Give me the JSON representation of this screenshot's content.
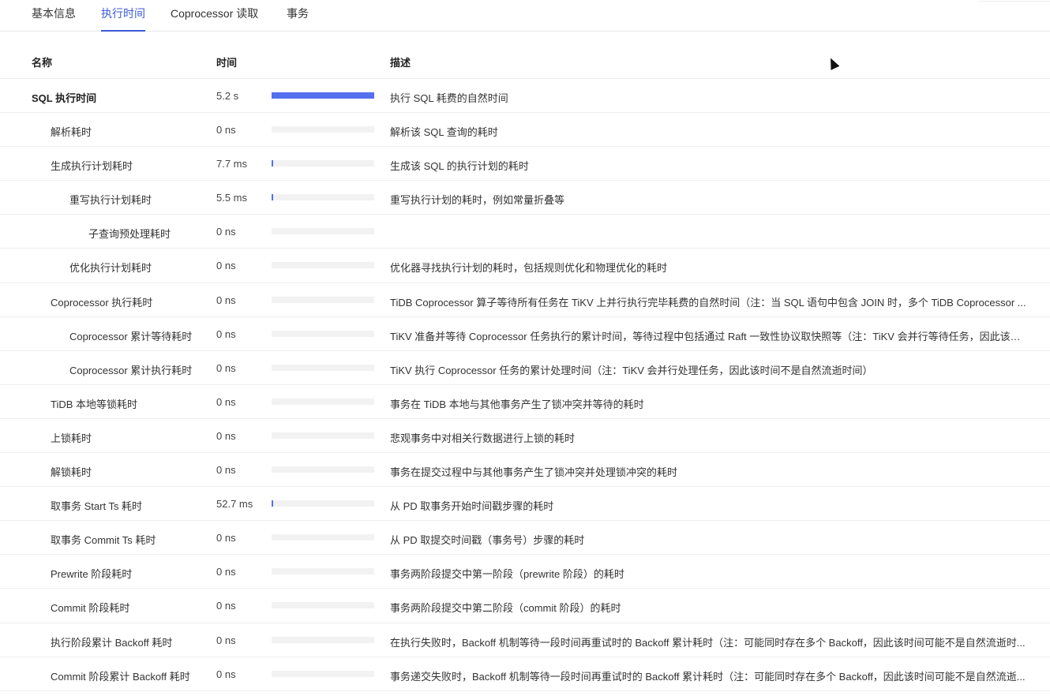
{
  "tabs": [
    {
      "label": "基本信息",
      "active": false
    },
    {
      "label": "执行时间",
      "active": true
    },
    {
      "label": "Coprocessor 读取",
      "active": false
    },
    {
      "label": "事务",
      "active": false
    }
  ],
  "header": {
    "name": "名称",
    "time": "时间",
    "desc": "描述"
  },
  "accent": "#5470ef",
  "rows": [
    {
      "name": "SQL 执行时间",
      "level": 0,
      "bold": true,
      "time": "5.2 s",
      "fraction": 1.0,
      "desc": "执行 SQL 耗费的自然时间"
    },
    {
      "name": "解析耗时",
      "level": 1,
      "time": "0 ns",
      "fraction": 0,
      "desc": "解析该 SQL 查询的耗时"
    },
    {
      "name": "生成执行计划耗时",
      "level": 1,
      "time": "7.7 ms",
      "fraction": 0.0015,
      "desc": "生成该 SQL 的执行计划的耗时"
    },
    {
      "name": "重写执行计划耗时",
      "level": 2,
      "time": "5.5 ms",
      "fraction": 0.001,
      "desc": "重写执行计划的耗时，例如常量折叠等"
    },
    {
      "name": "子查询预处理耗时",
      "level": 3,
      "time": "0 ns",
      "fraction": 0,
      "desc": ""
    },
    {
      "name": "优化执行计划耗时",
      "level": 2,
      "time": "0 ns",
      "fraction": 0,
      "desc": "优化器寻找执行计划的耗时，包括规则优化和物理优化的耗时"
    },
    {
      "name": "Coprocessor 执行耗时",
      "level": 1,
      "time": "0 ns",
      "fraction": 0,
      "desc": "TiDB Coprocessor 算子等待所有任务在 TiKV 上并行执行完毕耗费的自然时间（注：当 SQL 语句中包含 JOIN 时，多个 TiDB Coprocessor ..."
    },
    {
      "name": "Coprocessor 累计等待耗时",
      "level": 2,
      "time": "0 ns",
      "fraction": 0,
      "desc": "TiKV 准备并等待 Coprocessor 任务执行的累计时间，等待过程中包括通过 Raft 一致性协议取快照等（注：TiKV 会并行等待任务，因此该时..."
    },
    {
      "name": "Coprocessor 累计执行耗时",
      "level": 2,
      "time": "0 ns",
      "fraction": 0,
      "desc": "TiKV 执行 Coprocessor 任务的累计处理时间（注：TiKV 会并行处理任务，因此该时间不是自然流逝时间）"
    },
    {
      "name": "TiDB 本地等锁耗时",
      "level": 1,
      "time": "0 ns",
      "fraction": 0,
      "desc": "事务在 TiDB 本地与其他事务产生了锁冲突并等待的耗时"
    },
    {
      "name": "上锁耗时",
      "level": 1,
      "time": "0 ns",
      "fraction": 0,
      "desc": "悲观事务中对相关行数据进行上锁的耗时"
    },
    {
      "name": "解锁耗时",
      "level": 1,
      "time": "0 ns",
      "fraction": 0,
      "desc": "事务在提交过程中与其他事务产生了锁冲突并处理锁冲突的耗时"
    },
    {
      "name": "取事务 Start Ts 耗时",
      "level": 1,
      "time": "52.7 ms",
      "fraction": 0.01,
      "desc": "从 PD 取事务开始时间戳步骤的耗时"
    },
    {
      "name": "取事务 Commit Ts 耗时",
      "level": 1,
      "time": "0 ns",
      "fraction": 0,
      "desc": "从 PD 取提交时间戳（事务号）步骤的耗时"
    },
    {
      "name": "Prewrite 阶段耗时",
      "level": 1,
      "time": "0 ns",
      "fraction": 0,
      "desc": "事务两阶段提交中第一阶段（prewrite 阶段）的耗时"
    },
    {
      "name": "Commit 阶段耗时",
      "level": 1,
      "time": "0 ns",
      "fraction": 0,
      "desc": "事务两阶段提交中第二阶段（commit 阶段）的耗时"
    },
    {
      "name": "执行阶段累计 Backoff 耗时",
      "level": 1,
      "time": "0 ns",
      "fraction": 0,
      "desc": "在执行失败时，Backoff 机制等待一段时间再重试时的 Backoff 累计耗时（注：可能同时存在多个 Backoff，因此该时间可能不是自然流逝时..."
    },
    {
      "name": "Commit 阶段累计 Backoff 耗时",
      "level": 1,
      "time": "0 ns",
      "fraction": 0,
      "desc": "事务递交失败时，Backoff 机制等待一段时间再重试时的 Backoff 累计耗时（注：可能同时存在多个 Backoff，因此该时间可能不是自然流逝..."
    }
  ]
}
